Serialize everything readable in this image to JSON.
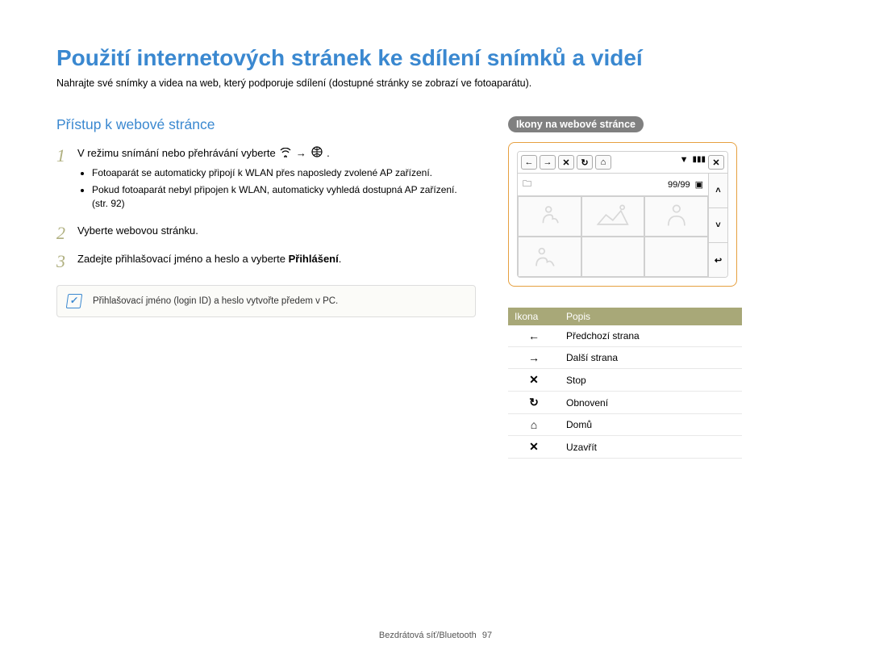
{
  "title": "Použití internetových stránek ke sdílení snímků a videí",
  "subtitle": "Nahrajte své snímky a videa na web, který podporuje sdílení (dostupné stránky se zobrazí ve fotoaparátu).",
  "section_heading": "Přístup k webové stránce",
  "steps": {
    "s1": {
      "num": "1",
      "pre": "V režimu snímání nebo přehrávání vyberte ",
      "arrow": "→",
      "post": ".",
      "bullets": [
        "Fotoaparát se automaticky připojí k WLAN přes naposledy zvolené AP zařízení.",
        "Pokud fotoaparát nebyl připojen k WLAN, automaticky vyhledá dostupná AP zařízení. (str. 92)"
      ]
    },
    "s2": {
      "num": "2",
      "text": "Vyberte webovou stránku."
    },
    "s3": {
      "num": "3",
      "pre": "Zadejte přihlašovací jméno a heslo a vyberte ",
      "bold": "Přihlášení",
      "post": "."
    }
  },
  "note": "Přihlašovací jméno (login ID) a heslo vytvořte předem v PC.",
  "right_heading": "Ikony na webové stránce",
  "device": {
    "counter": "99/99"
  },
  "table": {
    "th_icon": "Ikona",
    "th_desc": "Popis",
    "rows": [
      {
        "glyph": "←",
        "desc": "Předchozí strana"
      },
      {
        "glyph": "→",
        "desc": "Další strana"
      },
      {
        "glyph": "✕",
        "desc": "Stop"
      },
      {
        "glyph": "↻",
        "desc": "Obnovení"
      },
      {
        "glyph": "⌂",
        "desc": "Domů"
      },
      {
        "glyph": "✕",
        "desc": "Uzavřít"
      }
    ]
  },
  "footer": {
    "text": "Bezdrátová síť/Bluetooth",
    "page": "97"
  }
}
